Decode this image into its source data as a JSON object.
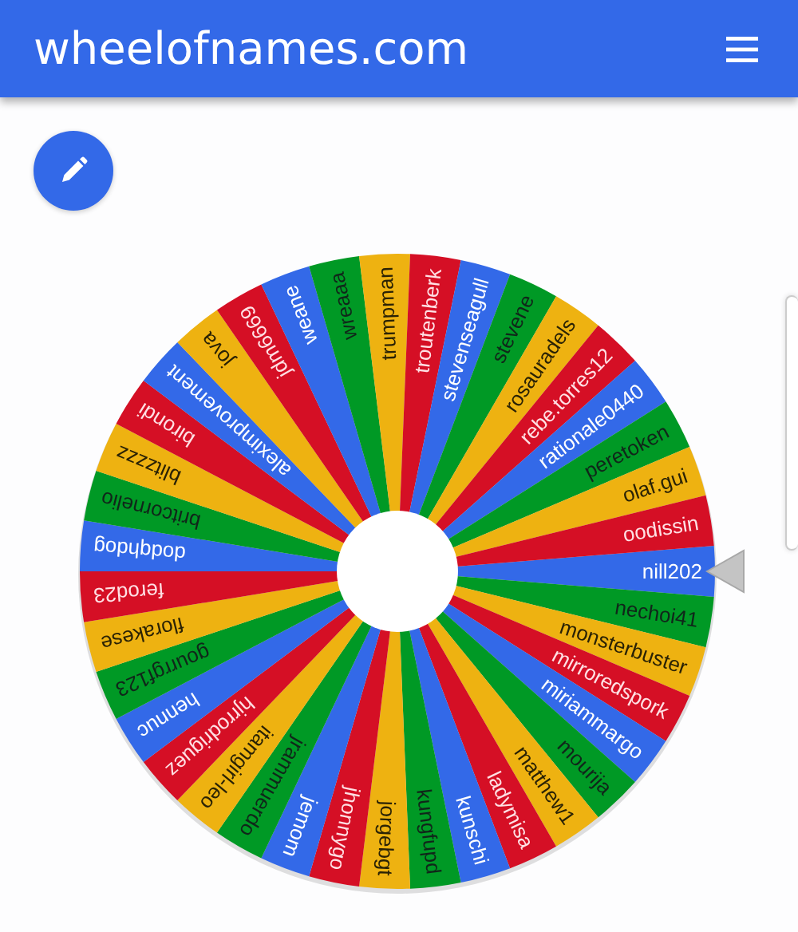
{
  "header": {
    "title": "wheelofnames.com"
  },
  "wheel": {
    "slices": [
      {
        "label": "nill202",
        "color": "#3369e8"
      },
      {
        "label": "nechoi41",
        "color": "#009925"
      },
      {
        "label": "monsterbuster",
        "color": "#eeb211"
      },
      {
        "label": "mirroredspork",
        "color": "#d50f25"
      },
      {
        "label": "miriammargo",
        "color": "#3369e8"
      },
      {
        "label": "mourija",
        "color": "#009925"
      },
      {
        "label": "matthew1",
        "color": "#eeb211"
      },
      {
        "label": "ladymisa",
        "color": "#d50f25"
      },
      {
        "label": "kunschi",
        "color": "#3369e8"
      },
      {
        "label": "kungfupd",
        "color": "#009925"
      },
      {
        "label": "jorgebgt",
        "color": "#eeb211"
      },
      {
        "label": "jhonnygo",
        "color": "#d50f25"
      },
      {
        "label": "jemom",
        "color": "#3369e8"
      },
      {
        "label": "jrammuerdo",
        "color": "#009925"
      },
      {
        "label": "itamgirl-leo",
        "color": "#eeb211"
      },
      {
        "label": "hjrrodriguez",
        "color": "#d50f25"
      },
      {
        "label": "hennuc",
        "color": "#3369e8"
      },
      {
        "label": "gourrgf123",
        "color": "#009925"
      },
      {
        "label": "florakese",
        "color": "#eeb211"
      },
      {
        "label": "ferod23",
        "color": "#d50f25"
      },
      {
        "label": "dodqhdog",
        "color": "#3369e8"
      },
      {
        "label": "britcornelio",
        "color": "#009925"
      },
      {
        "label": "blitzzzz",
        "color": "#eeb211"
      },
      {
        "label": "birondi",
        "color": "#d50f25"
      },
      {
        "label": "aleximprovement",
        "color": "#3369e8"
      },
      {
        "label": "jova",
        "color": "#eeb211"
      },
      {
        "label": "jdm6669",
        "color": "#d50f25"
      },
      {
        "label": "weane",
        "color": "#3369e8"
      },
      {
        "label": "wreaaa",
        "color": "#009925"
      },
      {
        "label": "trumpman",
        "color": "#eeb211"
      },
      {
        "label": "troutenberk",
        "color": "#d50f25"
      },
      {
        "label": "stevenseagull",
        "color": "#3369e8"
      },
      {
        "label": "stevene",
        "color": "#009925"
      },
      {
        "label": "rosauradels",
        "color": "#eeb211"
      },
      {
        "label": "rebe.torres12",
        "color": "#d50f25"
      },
      {
        "label": "rationale0440",
        "color": "#3369e8"
      },
      {
        "label": "peretoken",
        "color": "#009925"
      },
      {
        "label": "olaf.gui",
        "color": "#eeb211"
      },
      {
        "label": "oodissin",
        "color": "#d50f25"
      }
    ]
  }
}
